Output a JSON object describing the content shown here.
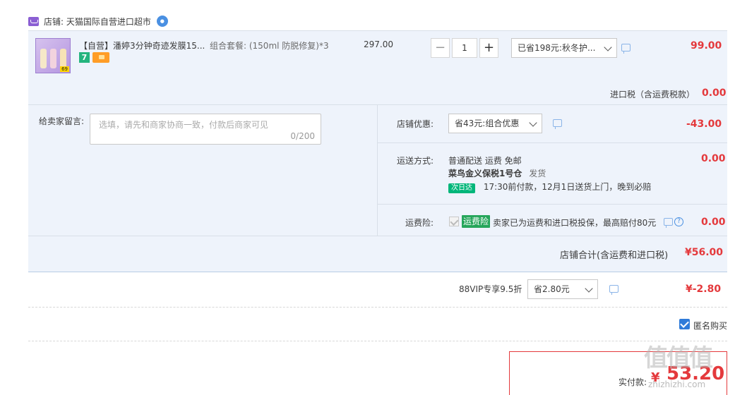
{
  "shop": {
    "name": "店铺: 天猫国际自营进口超市"
  },
  "item": {
    "title": "【自营】潘婷3分钟奇迹发膜15...",
    "sku": "组合套餐: (150ml 防脱修复)*3",
    "unit_price": "297.00",
    "thumb_tag": "69",
    "badge_7": "7",
    "quantity": "1",
    "qty_minus": "−",
    "qty_plus": "+",
    "promo_select": "已省198元:秋冬护...",
    "subtotal": "99.00",
    "tax_label": "进口税（含运费税款）",
    "tax_value": "0.00"
  },
  "message": {
    "label": "给卖家留言:",
    "placeholder": "选填，请先和商家协商一致，付款后商家可见",
    "count": "0/200"
  },
  "shop_discount": {
    "label": "店铺优惠:",
    "select": "省43元:组合优惠",
    "value": "-43.00"
  },
  "shipping": {
    "label": "运送方式:",
    "line1": "普通配送 运费 免邮",
    "warehouse": "菜鸟金义保税1号仓",
    "warehouse_suffix": "发货",
    "nextday_badge": "次日达",
    "delivery": "17:30前付款，12月1日送货上门，晚到必赔",
    "value": "0.00"
  },
  "insurance": {
    "label": "运费险:",
    "badge": "运费险",
    "text": "卖家已为运费和进口税投保，最高赔付80元",
    "qmark": "?",
    "value": "0.00"
  },
  "shop_total": {
    "label": "店铺合计(含运费和进口税)",
    "value": "¥56.00"
  },
  "vip": {
    "label": "88VIP专享9.5折",
    "select": "省2.80元",
    "value": "¥-2.80"
  },
  "anonymous": {
    "label": "匿名购买"
  },
  "payment": {
    "label": "实付款:",
    "currency": "¥",
    "amount": "53.20"
  },
  "watermark": {
    "text": "值值值",
    "sub": "zhizhizhi.com"
  }
}
